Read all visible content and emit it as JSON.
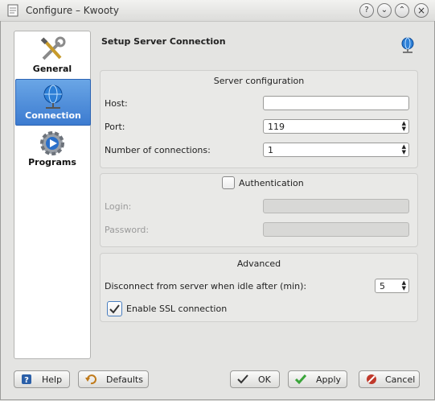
{
  "window": {
    "title": "Configure – Kwooty",
    "controls": [
      "help",
      "minimize",
      "maximize",
      "close"
    ]
  },
  "sidebar": {
    "items": [
      {
        "label": "General",
        "icon": "tools-icon",
        "active": false
      },
      {
        "label": "Connection",
        "icon": "network-globe-icon",
        "active": true
      },
      {
        "label": "Programs",
        "icon": "gear-play-icon",
        "active": false
      }
    ]
  },
  "page": {
    "title": "Setup Server Connection",
    "header_icon": "network-globe-icon"
  },
  "server_configuration": {
    "title": "Server configuration",
    "host_label": "Host:",
    "host_value": "",
    "port_label": "Port:",
    "port_value": "119",
    "connections_label": "Number of connections:",
    "connections_value": "1"
  },
  "authentication": {
    "title": "Authentication",
    "checked": false,
    "login_label": "Login:",
    "login_value": "",
    "password_label": "Password:",
    "password_value": ""
  },
  "advanced": {
    "title": "Advanced",
    "disconnect_label": "Disconnect from server when idle after (min):",
    "disconnect_value": "5",
    "ssl_label": "Enable SSL connection",
    "ssl_checked": true
  },
  "buttons": {
    "help": "Help",
    "defaults": "Defaults",
    "ok": "OK",
    "apply": "Apply",
    "cancel": "Cancel"
  },
  "colors": {
    "selection": "#3c7bd0",
    "window_bg": "#e4e4e2",
    "cancel_red": "#c0392b",
    "apply_green": "#3aa53a"
  }
}
